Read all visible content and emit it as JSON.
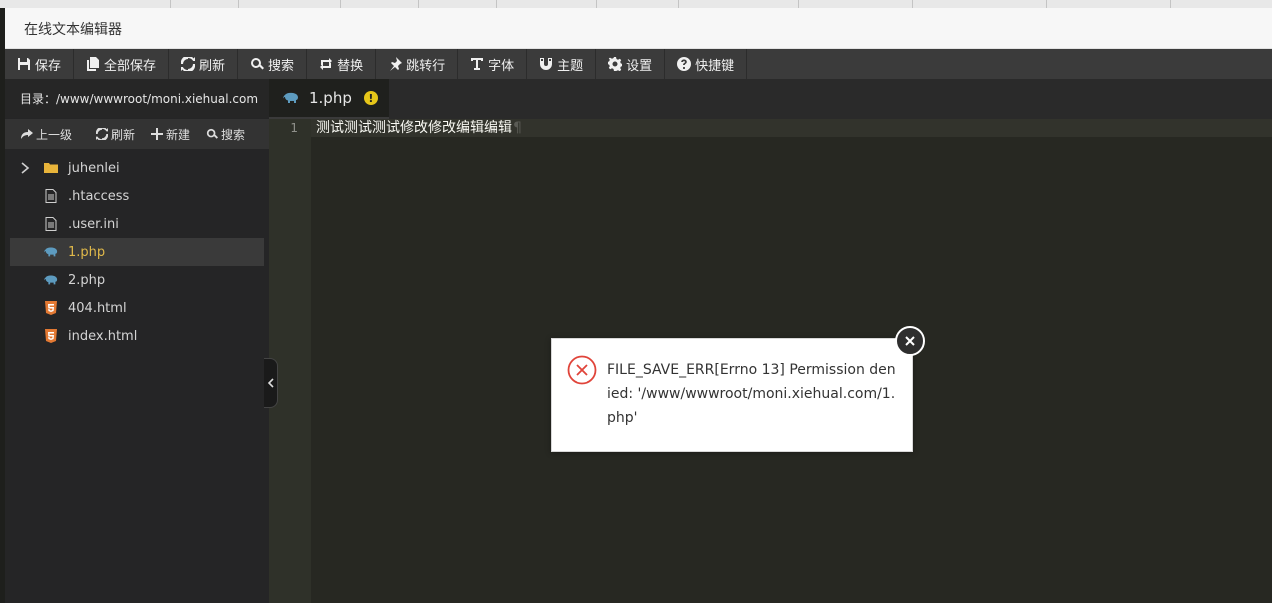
{
  "window": {
    "title": "在线文本编辑器"
  },
  "toolbar": {
    "save": "保存",
    "save_all": "全部保存",
    "refresh": "刷新",
    "search": "搜索",
    "replace": "替换",
    "goto_line": "跳转行",
    "font": "字体",
    "theme": "主题",
    "settings": "设置",
    "shortcuts": "快捷键"
  },
  "sidebar": {
    "directory": "目录：/www/wwwroot/moni.xiehual.com",
    "actions": {
      "up": "上一级",
      "refresh": "刷新",
      "new": "新建",
      "search": "搜索"
    },
    "files": [
      {
        "name": "juhenlei",
        "type": "folder"
      },
      {
        "name": ".htaccess",
        "type": "file"
      },
      {
        "name": ".user.ini",
        "type": "file"
      },
      {
        "name": "1.php",
        "type": "php",
        "active": true
      },
      {
        "name": "2.php",
        "type": "php"
      },
      {
        "name": "404.html",
        "type": "html"
      },
      {
        "name": "index.html",
        "type": "html"
      }
    ]
  },
  "editor": {
    "tab": {
      "name": "1.php",
      "warning": "!"
    },
    "line_number": "1",
    "line_text": "测试测试测试修改修改编辑编辑",
    "pilcrow": "¶"
  },
  "dialog": {
    "message": "FILE_SAVE_ERR[Errno 13] Permission denied: '/www/wwwroot/moni.xiehual.com/1.php'"
  },
  "colors": {
    "active_file": "#e0b94a",
    "error_red": "#e0443a",
    "warning_yellow": "#e6c619",
    "php_icon": "#5d9bbf",
    "html_icon": "#e37933",
    "folder": "#e8b43a"
  }
}
